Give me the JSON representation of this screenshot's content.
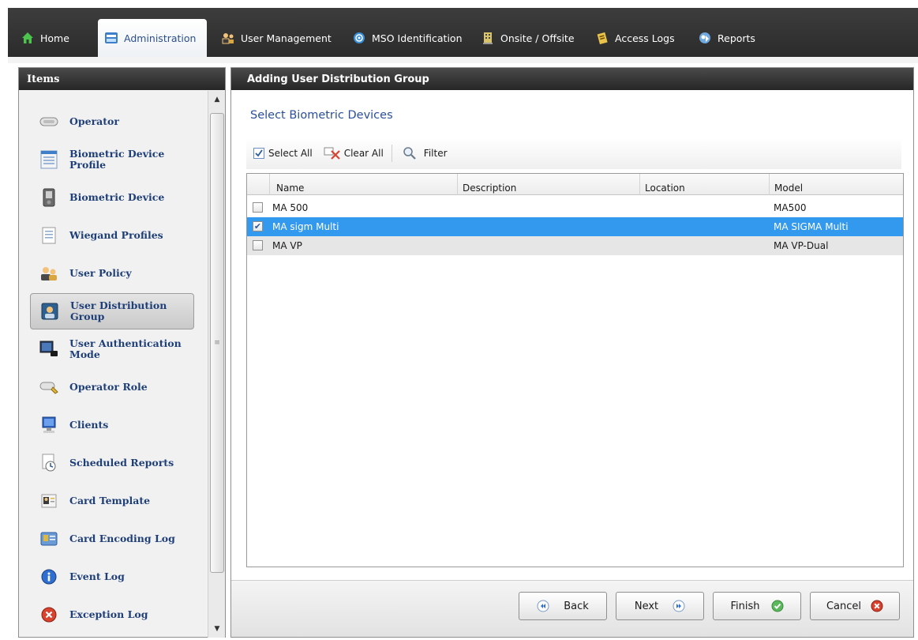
{
  "nav": {
    "tabs": [
      {
        "label": "Home",
        "icon": "home-icon"
      },
      {
        "label": "Administration",
        "icon": "administration-icon"
      },
      {
        "label": "User Management",
        "icon": "user-management-icon"
      },
      {
        "label": "MSO Identification",
        "icon": "mso-identification-icon"
      },
      {
        "label": "Onsite / Offsite",
        "icon": "building-icon"
      },
      {
        "label": "Access Logs",
        "icon": "access-logs-icon"
      },
      {
        "label": "Reports",
        "icon": "reports-icon"
      }
    ],
    "active_tab": "Administration"
  },
  "sidebar": {
    "title": "Items",
    "items": [
      {
        "label": "Operator",
        "icon": "operator-icon"
      },
      {
        "label": "Biometric Device Profile",
        "icon": "device-profile-icon"
      },
      {
        "label": "Biometric Device",
        "icon": "biometric-device-icon"
      },
      {
        "label": "Wiegand Profiles",
        "icon": "wiegand-profile-icon"
      },
      {
        "label": "User Policy",
        "icon": "user-policy-icon"
      },
      {
        "label": "User Distribution Group",
        "icon": "user-distribution-group-icon"
      },
      {
        "label": "User Authentication Mode",
        "icon": "user-authentication-icon"
      },
      {
        "label": "Operator Role",
        "icon": "operator-role-icon"
      },
      {
        "label": "Clients",
        "icon": "clients-icon"
      },
      {
        "label": "Scheduled Reports",
        "icon": "scheduled-reports-icon"
      },
      {
        "label": "Card Template",
        "icon": "card-template-icon"
      },
      {
        "label": "Card Encoding Log",
        "icon": "card-encoding-log-icon"
      },
      {
        "label": "Event Log",
        "icon": "event-log-icon"
      },
      {
        "label": "Exception Log",
        "icon": "exception-log-icon"
      }
    ],
    "selected_item": "User Distribution Group"
  },
  "main": {
    "title": "Adding User Distribution Group",
    "subtitle": "Select Biometric Devices",
    "toolbar": {
      "select_all": "Select All",
      "clear_all": "Clear All",
      "filter": "Filter"
    },
    "table": {
      "columns": [
        "Name",
        "Description",
        "Location",
        "Model"
      ],
      "rows": [
        {
          "checked": false,
          "name": "MA 500",
          "description": "",
          "location": "",
          "model": "MA500"
        },
        {
          "checked": true,
          "name": "MA sigm Multi",
          "description": "",
          "location": "",
          "model": "MA SIGMA Multi"
        },
        {
          "checked": false,
          "name": "MA VP",
          "description": "",
          "location": "",
          "model": "MA VP-Dual"
        }
      ]
    },
    "buttons": {
      "back": "Back",
      "next": "Next",
      "finish": "Finish",
      "cancel": "Cancel"
    }
  },
  "colors": {
    "selected_row": "#3399ee",
    "header_dark": "#262626",
    "link_blue": "#1f3f78"
  }
}
